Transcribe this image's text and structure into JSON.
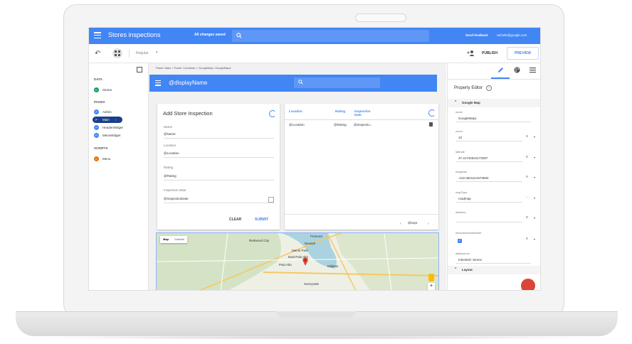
{
  "app": {
    "title": "Stores inspections",
    "save_status": "All changes saved",
    "feedback": "Send feedback",
    "user_email": "rachelk@google.com"
  },
  "toolbar": {
    "theme_select": "Regular",
    "publish_label": "PUBLISH",
    "preview_label": "PREVIEW"
  },
  "sidebar": {
    "data_heading": "DATA",
    "data_items": [
      {
        "letter": "D",
        "label": "Stores"
      }
    ],
    "pages_heading": "PAGES",
    "pages": [
      {
        "letter": "P",
        "label": "Admin"
      },
      {
        "letter": "P",
        "label": "Main"
      },
      {
        "letter": "P",
        "label": "HeaderWidget"
      },
      {
        "letter": "P",
        "label": "MenuWidget"
      }
    ],
    "scripts_heading": "SCRIPTS",
    "scripts": [
      {
        "letter": "C",
        "label": "Menu"
      }
    ]
  },
  "canvas": {
    "breadcrumb": "Panel: Main > Panel: Container > GoogleMap: GoogleMap1",
    "page_title": "@displayName",
    "form": {
      "title": "Add Store Inspection",
      "fields": [
        {
          "label": "Name",
          "value": "@Name"
        },
        {
          "label": "Location",
          "value": "@Location"
        },
        {
          "label": "Rating",
          "value": "@Rating"
        },
        {
          "label": "Inspection Date",
          "value": "@InspectionDate"
        }
      ],
      "clear_label": "CLEAR",
      "submit_label": "SUBMIT"
    },
    "table": {
      "columns": [
        "Location",
        "Rating",
        "Inspection Date"
      ],
      "row": [
        "@Location",
        "@Rating",
        "@Inspectio..."
      ],
      "page_expr": "@expr"
    },
    "map": {
      "type_map": "Map",
      "type_satellite": "Satellite",
      "places": [
        "Fremont",
        "Newark",
        "Menlo Park",
        "East Palo Alto",
        "Palo Alto",
        "Milpitas",
        "Sunnyvale",
        "Redwood City"
      ]
    }
  },
  "property_editor": {
    "title": "Property Editor",
    "section": "Google Map",
    "props": [
      {
        "label": "name",
        "value": "GoogleMap1"
      },
      {
        "label": "zoom",
        "value": "10"
      },
      {
        "label": "latitude",
        "value": "37.41734524173287"
      },
      {
        "label": "longitude",
        "value": "-122.0841121673584"
      },
      {
        "label": "mapType",
        "value": "roadmap"
      },
      {
        "label": "address",
        "value": ""
      },
      {
        "label": "showAddressMarker",
        "value": ""
      },
      {
        "label": "datasource",
        "value": "Inherited: Stores"
      }
    ],
    "layout_section": "Layout"
  },
  "colors": {
    "primary": "#4285f4",
    "main_pill": "#1a3f8a",
    "data_dot": "#0f9d58",
    "page_dot": "#4285f4",
    "script_dot": "#e8710a",
    "fab": "#db4437"
  }
}
